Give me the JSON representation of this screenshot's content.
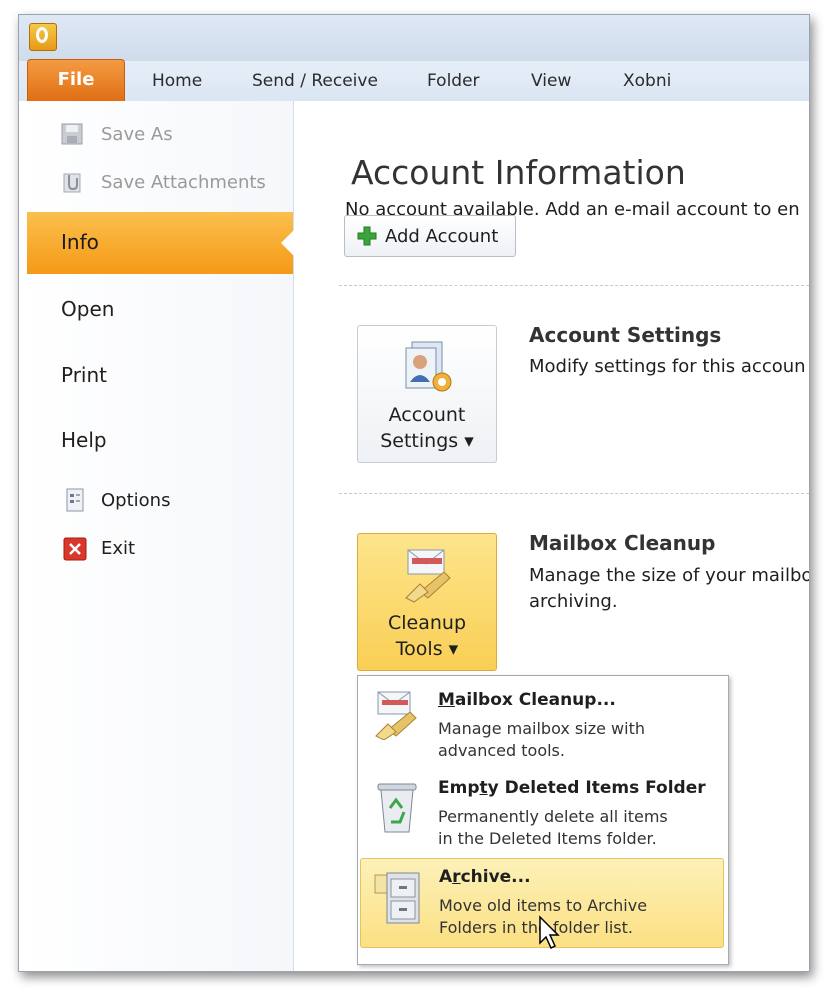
{
  "ribbon": {
    "file_label": "File",
    "tabs": [
      "Home",
      "Send / Receive",
      "Folder",
      "View",
      "Xobni"
    ]
  },
  "backstage": {
    "commands": [
      "Save As",
      "Save Attachments"
    ],
    "nav": [
      "Info",
      "Open",
      "Print",
      "Help"
    ],
    "small": [
      "Options",
      "Exit"
    ],
    "selected": "Info"
  },
  "info": {
    "heading": "Account Information",
    "no_account_text": "No account available. Add an e-mail account to en",
    "add_account_label": "Add Account",
    "account_settings": {
      "button_line1": "Account",
      "button_line2": "Settings ▾",
      "title": "Account Settings",
      "desc": "Modify settings for this accoun"
    },
    "mailbox_cleanup": {
      "button_line1": "Cleanup",
      "button_line2": "Tools ▾",
      "title": "Mailbox Cleanup",
      "desc_line1": "Manage the size of your mailbo",
      "desc_line2": "archiving."
    }
  },
  "menu": {
    "items": [
      {
        "title_u": "M",
        "title_rest": "ailbox Cleanup...",
        "desc1": "Manage mailbox size with",
        "desc2": "advanced tools."
      },
      {
        "title_pre": "Emp",
        "title_u": "t",
        "title_rest": "y Deleted Items Folder",
        "desc1": "Permanently delete all items",
        "desc2": "in the Deleted Items folder."
      },
      {
        "title_pre": "A",
        "title_u": "r",
        "title_rest": "chive...",
        "desc1": "Move old items to Archive",
        "desc2": "Folders in the folder list."
      }
    ]
  },
  "colors": {
    "accent_orange": "#f59a16",
    "file_tab": "#e06d12",
    "highlight_yellow": "#fbe083"
  }
}
